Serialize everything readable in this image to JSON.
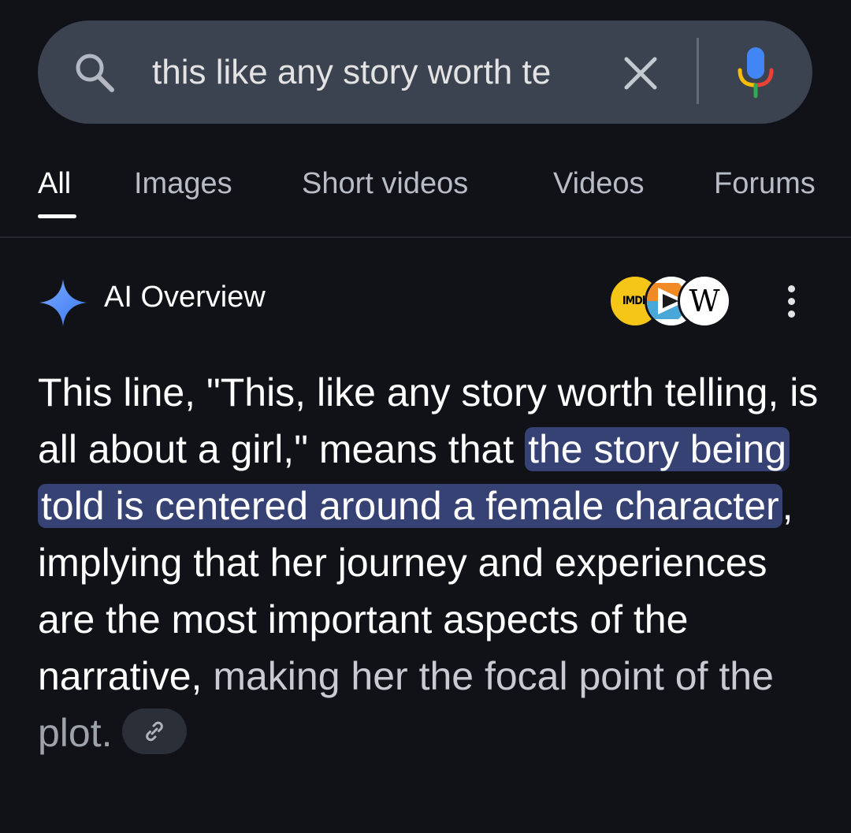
{
  "search": {
    "query": "this like any story worth te",
    "icons": [
      "search-icon",
      "close-icon",
      "microphone-icon"
    ]
  },
  "tabs": [
    {
      "label": "All",
      "active": true
    },
    {
      "label": "Images",
      "active": false
    },
    {
      "label": "Short videos",
      "active": false
    },
    {
      "label": "Videos",
      "active": false
    },
    {
      "label": "Forums",
      "active": false
    }
  ],
  "ai_overview": {
    "title": "AI Overview",
    "sources": [
      {
        "name": "IMDb",
        "label": "IMDb"
      },
      {
        "name": "media-player",
        "label": ""
      },
      {
        "name": "Wikipedia",
        "label": "W"
      }
    ],
    "answer": {
      "part1": "This line, \"This, like any story worth telling, is all about a girl,\" means that",
      "highlight": "the story being told is centered around a female character",
      "part2": ", implying that her journey and experiences are the most important aspects of the narrative,",
      "part3": "making her the focal point of the",
      "part4": "plot."
    }
  },
  "colors": {
    "background": "#101218",
    "search_bar": "#3c4350",
    "highlight": "#364174",
    "spark_blue": "#4f8df8"
  }
}
